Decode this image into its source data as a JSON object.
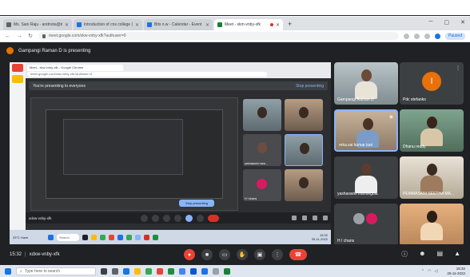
{
  "browser": {
    "tabs": [
      {
        "label": "Ms. Sani Raju - andnota@du.edu.in - ..."
      },
      {
        "label": "Introduction of cns college (HC)..."
      },
      {
        "label": "Bits n.w - Calendar - Event desc..."
      },
      {
        "label": "Meet - xkm-vnby-xfk",
        "active": true
      }
    ],
    "new_tab": "+",
    "url": "meet.google.com/xkw-vnby-xfk?authuser=0",
    "profile": "Paused"
  },
  "banner": {
    "text": "Gampangi Raman D is presenting"
  },
  "presentation": {
    "nested_tab": "Meet - xkw-vnby-xfk - Google Chrome",
    "nested_url": "meet.google.com/xkw-vnby-xfk?authuser=0",
    "notice": "You're presenting to everyone",
    "stop_link": "Stop presenting",
    "left_caption": "vidya gayas has left the meeting",
    "mid_caption_1": "ch Lubra lai kumari",
    "mid_caption_2": "balaam",
    "stop_button": "Stop presenting",
    "under_label": "Ignore",
    "meeting_code": "xdxw-vnby-xfk",
    "tiles": [
      {
        "name": ""
      },
      {
        "name": ""
      },
      {
        "name": "yashaswini nara..."
      },
      {
        "name": ""
      },
      {
        "name": "H I chans"
      },
      {
        "name": ""
      }
    ],
    "taskbar_weather": "33°C Haze",
    "taskbar_search": "Search",
    "taskbar_time": "15:32",
    "taskbar_date": "25-11-2022"
  },
  "participants": [
    {
      "name": "Gampangi Raman D"
    },
    {
      "name": "Pdc stefanko",
      "initial": "I"
    },
    {
      "name": "reka.sai kumar kari"
    },
    {
      "name": "Dhanu reddy"
    },
    {
      "name": "yashaswini mandegula"
    },
    {
      "name": "PEMMASANI SEETHA MA..."
    },
    {
      "name": "H I chans"
    },
    {
      "name": ""
    }
  ],
  "meet_bar": {
    "time": "15:32",
    "separator": "|",
    "code": "xdxw-vnby-xfk"
  },
  "taskbar": {
    "search_placeholder": "Type here to search",
    "time": "15:32",
    "date": "25-11-2022"
  },
  "colors": {
    "meet_bg": "#202124",
    "end_call": "#ea4335",
    "presenter_dot": "#e37400",
    "selected_border": "#8ab4f8"
  }
}
